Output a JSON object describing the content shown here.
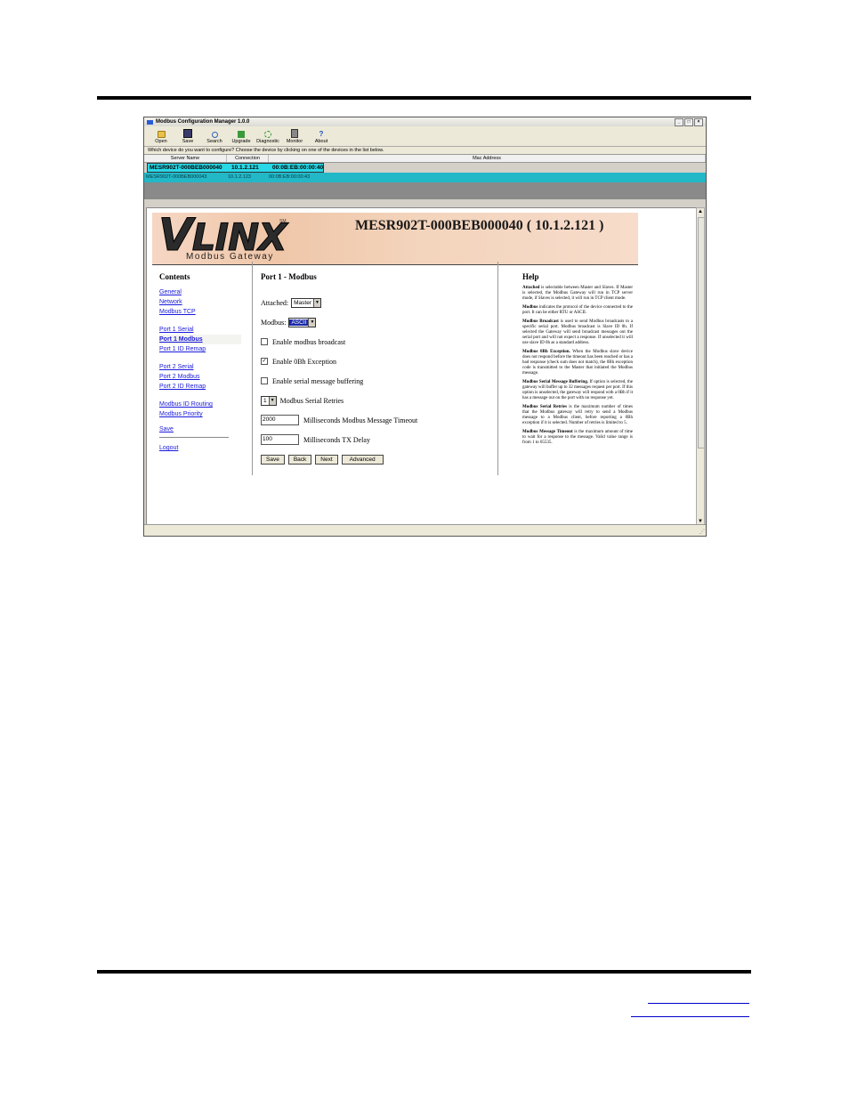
{
  "window": {
    "title": "Modbus Configuration Manager 1.0.0",
    "min_glyph": "_",
    "max_glyph": "□",
    "close_glyph": "×"
  },
  "toolbar": {
    "items": [
      {
        "label": "Open",
        "icon": "folder-icon"
      },
      {
        "label": "Save",
        "icon": "disk-icon"
      },
      {
        "label": "Search",
        "icon": "magnifier-icon"
      },
      {
        "label": "Upgrade",
        "icon": "upgrade-icon"
      },
      {
        "label": "Diagnostic",
        "icon": "antenna-icon"
      },
      {
        "label": "Monitor",
        "icon": "monitor-icon"
      },
      {
        "label": "About",
        "icon": "question-icon",
        "glyph": "?"
      }
    ]
  },
  "prompt": "Which device do you want to configure? Choose the device by clicking on one of the devices in the list below.",
  "device_table": {
    "headers": [
      "Server Name",
      "Connection",
      "Mac Address"
    ],
    "rows": [
      {
        "name": "MESR902T-000BEB000040",
        "connection": "10.1.2.121",
        "mac": "00:0B:EB:00:00:40"
      },
      {
        "name": "MESR902T-000BEB000043",
        "connection": "10.1.2.123",
        "mac": "00:0B:EB:00:00:43"
      }
    ]
  },
  "banner": {
    "logo_v": "V",
    "logo_rest": "LINX",
    "sm": "SM",
    "subtitle": "Modbus Gateway",
    "device_title": "MESR902T-000BEB000040 ( 10.1.2.121 )"
  },
  "contents": {
    "heading": "Contents",
    "links": {
      "general": "General",
      "network": "Network",
      "modbus_tcp": "Modbus TCP",
      "port1_serial": "Port 1 Serial",
      "port1_modbus": "Port 1 Modbus",
      "port1_id_remap": "Port 1 ID Remap",
      "port2_serial": "Port 2 Serial",
      "port2_modbus": "Port 2 Modbus",
      "port2_id_remap": "Port 2 ID Remap",
      "modbus_id_routing": "Modbus ID Routing",
      "modbus_priority": "Modbus Priority",
      "save": "Save",
      "logout": "Logout"
    }
  },
  "form": {
    "heading": "Port 1 - Modbus",
    "attached_label": "Attached:",
    "attached_value": "Master",
    "modbus_label": "Modbus:",
    "modbus_value": "ASCII",
    "enable_broadcast": {
      "label": "Enable modbus broadcast",
      "checked": false
    },
    "enable_exception": {
      "label": "Enable 0Bh Exception",
      "checked": true
    },
    "enable_buffering": {
      "label": "Enable serial message buffering",
      "checked": false
    },
    "retries_value": "1",
    "retries_label": "Modbus Serial Retries",
    "timeout_value": "2000",
    "timeout_label": "Milliseconds Modbus Message Timeout",
    "txdelay_value": "100",
    "txdelay_label": "Milliseconds TX Delay",
    "check_glyph": "✓",
    "dropdown_glyph": "▼",
    "buttons": {
      "save": "Save",
      "back": "Back",
      "next": "Next",
      "advanced": "Advanced"
    }
  },
  "help": {
    "heading": "Help",
    "paragraphs": [
      {
        "term": "Attached",
        "text": " is selectable between Master and Slaves. If Master is selected, the Modbus Gateway will run in TCP server mode, if Slaves is selected, it will run in TCP client mode."
      },
      {
        "term": "Modbus",
        "text": " indicates the protocol of the device connected to the port. It can be either RTU or ASCII."
      },
      {
        "term": "Modbus Broadcast",
        "text": " is used to send Modbus broadcasts to a specific serial port. Modbus broadcast is Slave ID 0h. If selected the Gateway will send broadcast messages out the serial port and will not expect a response. If unselected it will use slave ID 0h as a standard address."
      },
      {
        "term": "Modbus 0Bh Exception.",
        "text": " When the Modbus slave device does not respond before the timeout has been reached or has a bad response (check sum does not match), the 0Bh exception code is transmitted to the Master that initiated the Modbus message."
      },
      {
        "term": "Modbus Serial Message Buffering.",
        "text": " If option is selected, the gateway will buffer up to 32 messages request per port. If this option is unselected, the gateway will respond with a 0Bh if it has a message out on the port with no response yet."
      },
      {
        "term": "Modbus Serial Retries",
        "text": " is the maximum number of times that the Modbus gateway will retry to send a Modbus message to a Modbus client, before reporting a 0Bh exception if it is selected. Number of retries is limited to 5."
      },
      {
        "term": "Modbus Message Timeout",
        "text": " is the maximum amount of time to wait for a response to the message. Valid value range is from 1 to 65535."
      }
    ]
  },
  "scroll": {
    "up": "▲",
    "down": "▼",
    "grip": "⋰"
  }
}
